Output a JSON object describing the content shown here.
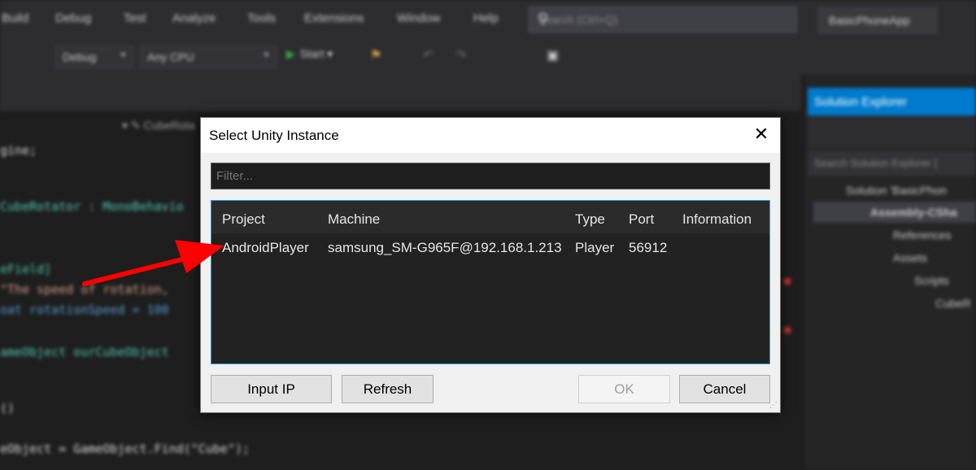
{
  "ide": {
    "menus": [
      "Build",
      "Debug",
      "Test",
      "Analyze",
      "Tools",
      "Extensions",
      "Window",
      "Help"
    ],
    "search_placeholder": "Search (Ctrl+Q)",
    "project_name": "BasicPhoneApp",
    "toolbar": {
      "config": "Debug",
      "platform": "Any CPU",
      "start_label": "Start"
    },
    "breadcrumb": "CubeRota",
    "code_lines": [
      "gine;",
      "CubeRotator : MonoBehavio",
      "eField]",
      "\"The speed of rotation, ",
      "oat rotationSpeed = 100",
      "ameObject ourCubeObject",
      "()",
      "eObject = GameObject.Find(\"Cube\");"
    ],
    "solution_explorer": {
      "title": "Solution Explorer",
      "search_placeholder": "Search Solution Explorer (",
      "tree": [
        "Solution 'BasicPhon",
        "Assembly-CSha",
        "References",
        "Assets",
        "Scripts",
        "CubeR"
      ]
    }
  },
  "dialog": {
    "title": "Select Unity Instance",
    "filter_placeholder": "Filter...",
    "columns": {
      "project": "Project",
      "machine": "Machine",
      "type": "Type",
      "port": "Port",
      "information": "Information"
    },
    "rows": [
      {
        "project": "AndroidPlayer",
        "machine": "samsung_SM-G965F@192.168.1.213",
        "type": "Player",
        "port": "56912",
        "information": ""
      }
    ],
    "buttons": {
      "input_ip": "Input IP",
      "refresh": "Refresh",
      "ok": "OK",
      "cancel": "Cancel"
    }
  },
  "colors": {
    "arrow": "#ff0000",
    "selection_border": "#1c97ea",
    "solution_explorer_title": "#007acc"
  },
  "icons": [
    "close-icon",
    "search-icon",
    "play-icon",
    "resize-grip-icon",
    "annotation-arrow"
  ]
}
